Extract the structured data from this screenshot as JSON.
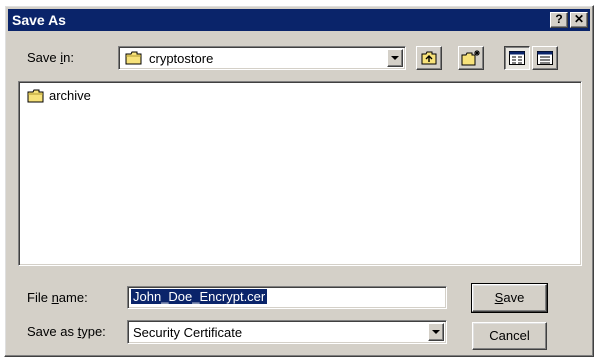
{
  "window": {
    "title": "Save As",
    "help_label": "?",
    "close_label": "✕"
  },
  "save_in": {
    "label_prefix": "Save ",
    "label_hotkey": "i",
    "label_suffix": "n:",
    "current_folder": "cryptostore"
  },
  "toolbar": {
    "up_icon": "up-one-level-icon",
    "new_folder_icon": "new-folder-icon",
    "list_view_icon": "list-view-icon",
    "details_view_icon": "details-view-icon"
  },
  "files": [
    {
      "name": "archive",
      "icon": "folder-icon"
    }
  ],
  "file_name": {
    "label_prefix": "File ",
    "label_hotkey": "n",
    "label_suffix": "ame:",
    "value": "John_Doe_Encrypt.cer"
  },
  "save_type": {
    "label_prefix": "Save as ",
    "label_hotkey": "t",
    "label_suffix": "ype:",
    "value": "Security Certificate"
  },
  "buttons": {
    "save_hotkey": "S",
    "save_rest": "ave",
    "cancel": "Cancel"
  },
  "colors": {
    "titlebar": "#0a246a",
    "face": "#d4d0c8",
    "selection": "#0a246a"
  }
}
